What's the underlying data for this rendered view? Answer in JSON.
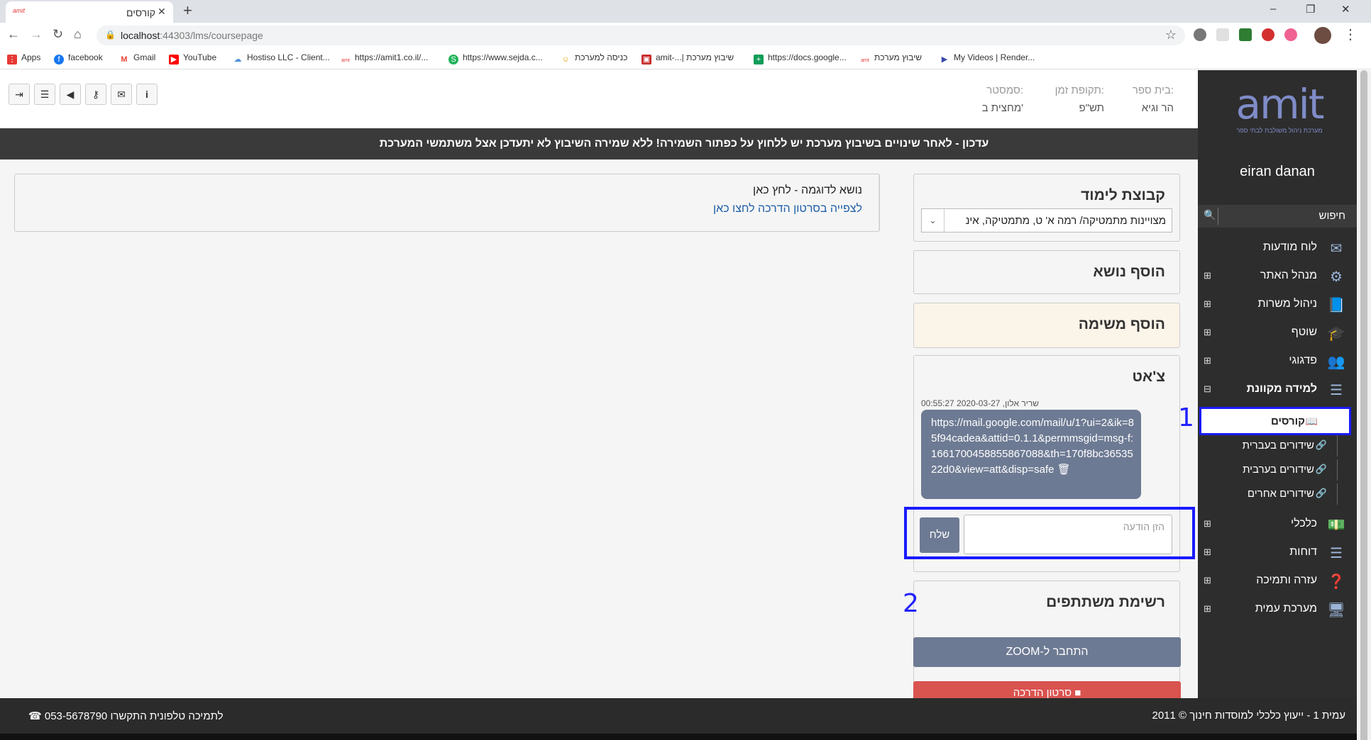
{
  "browser": {
    "tab_title": "קורסים",
    "tab_favicon_text": "amit",
    "url_host": "localhost",
    "url_rest": ":44303/lms/coursepage",
    "bookmarks": [
      {
        "label": "Apps",
        "icon": "apps-grid-icon",
        "color": "#e53935"
      },
      {
        "label": "facebook",
        "icon": "facebook-icon",
        "color": "#1877f2"
      },
      {
        "label": "Gmail",
        "icon": "gmail-icon",
        "color": "#ea4335"
      },
      {
        "label": "YouTube",
        "icon": "youtube-icon",
        "color": "#ff0000"
      },
      {
        "label": "Hostiso LLC - Client...",
        "icon": "cloud-icon",
        "color": "#4a90d9"
      },
      {
        "label": "https://amit1.co.il/...",
        "icon": "amit-icon",
        "color": "#e53935"
      },
      {
        "label": "https://www.sejda.c...",
        "icon": "sejda-icon",
        "color": "#20b35a"
      },
      {
        "label": "כניסה למערכת",
        "icon": "people-icon",
        "color": "#e0a400"
      },
      {
        "label": "amit-...| שיבוץ מערכת",
        "icon": "document-icon",
        "color": "#c62828"
      },
      {
        "label": "https://docs.google...",
        "icon": "sheets-icon",
        "color": "#0f9d58"
      },
      {
        "label": "שיבוץ מערכת",
        "icon": "amit-icon",
        "color": "#e53935"
      },
      {
        "label": "My Videos | Render...",
        "icon": "play-icon",
        "color": "#3949ab"
      }
    ]
  },
  "header": {
    "school_label": "בית ספר:",
    "school_value": "הר וגיא",
    "period_label": "תקופת זמן:",
    "period_value": "תש\"פ",
    "semester_label": "סמסטר:",
    "semester_value": "מחצית ב'"
  },
  "notice": "עדכון - לאחר שינויים בשיבוץ מערכת יש ללחוץ על כפתור השמירה! ללא שמירה השיבוץ לא יתעדכן אצל משתמשי המערכת",
  "sidebar": {
    "logo": "amit",
    "logo_sub": "מערכת ניהול משולבת לבתי ספר",
    "user_name": "eiran danan",
    "search_label": "חיפוש",
    "items": [
      {
        "label": "לוח מודעות",
        "icon": "envelope-icon",
        "expandable": false
      },
      {
        "label": "מנהל האתר",
        "icon": "gear-icon",
        "expandable": true
      },
      {
        "label": "ניהול משרות",
        "icon": "book-icon",
        "expandable": true
      },
      {
        "label": "שוטף",
        "icon": "graduation-cap-icon",
        "expandable": true
      },
      {
        "label": "פדגוגי",
        "icon": "users-icon",
        "expandable": true
      },
      {
        "label": "למידה מקוונת",
        "icon": "list-icon",
        "expandable": true,
        "expanded": true
      },
      {
        "label": "כלכלי",
        "icon": "money-icon",
        "expandable": true
      },
      {
        "label": "דוחות",
        "icon": "list-icon",
        "expandable": true
      },
      {
        "label": "עזרה ותמיכה",
        "icon": "question-icon",
        "expandable": true
      },
      {
        "label": "מערכת עמית",
        "icon": "monitor-icon",
        "expandable": true
      }
    ],
    "subitems": [
      {
        "label": "קורסים",
        "icon": "book-icon",
        "active": true
      },
      {
        "label": "שידורים בעברית",
        "icon": "link-icon"
      },
      {
        "label": "שידורים בערבית",
        "icon": "link-icon"
      },
      {
        "label": "שידורים אחרים",
        "icon": "link-icon"
      }
    ]
  },
  "annotations": [
    "1",
    "2"
  ],
  "learning_group": {
    "title": "קבוצת לימוד",
    "selected": "מצויינות מתמטיקה/ רמה א' ט, מתמטיקה, אינ"
  },
  "add_topic": "הוסף נושא",
  "add_task": "הוסף משימה",
  "chat": {
    "title": "צ'אט",
    "meta": "שריר אלון, 2020-03-27 00:55:27",
    "message": "https://mail.google.com/mail/u/1?ui=2&ik=85f94cadea&attid=0.1.1&permmsgid=msg-f:1661700458855867088&th=170f8bc3653522d0&view=att&disp=safe",
    "input_placeholder": "הזן הודעה",
    "send_label": "שלח"
  },
  "participants": {
    "title": "רשימת משתתפים",
    "zoom_button": "התחבר ל-ZOOM",
    "video_button": "סרטון הדרכה"
  },
  "topic": {
    "title": "נושא לדוגמה - לחץ כאן",
    "link": "לצפייה בסרטון הדרכה לחצו כאן"
  },
  "footer": {
    "support": "לתמיכה טלפונית התקשרו 053-5678790",
    "copyright": "עמית 1 - ייעוץ כלכלי למוסדות חינוך © 2011"
  }
}
